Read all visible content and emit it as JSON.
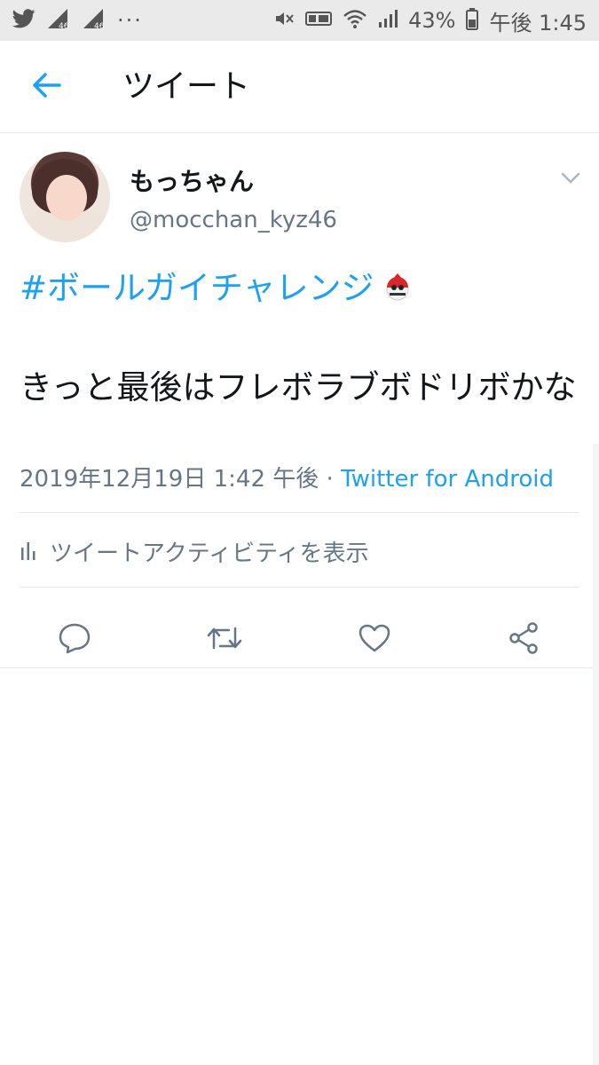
{
  "status_bar": {
    "battery": "43%",
    "time": "午後 1:45",
    "network_badges": [
      "46",
      "46"
    ],
    "more": "···"
  },
  "app_bar": {
    "title": "ツイート",
    "back_icon": "arrow-left-icon"
  },
  "tweet": {
    "display_name": "もっちゃん",
    "handle": "@mocchan_kyz46",
    "hashtag": "#ボールガイチャレンジ",
    "hashtag_emoji_icon": "ball-guy-emoji-icon",
    "body": "きっと最後はフレボラブボドリボかな",
    "timestamp": "2019年12月19日 1:42 午後 · ",
    "source": "Twitter for Android",
    "activity_label": "ツイートアクティビティを表示"
  },
  "colors": {
    "accent": "#1da1f2",
    "muted": "#657786",
    "divider": "#e1e8ed",
    "statusbar_bg": "#eaeaea"
  }
}
